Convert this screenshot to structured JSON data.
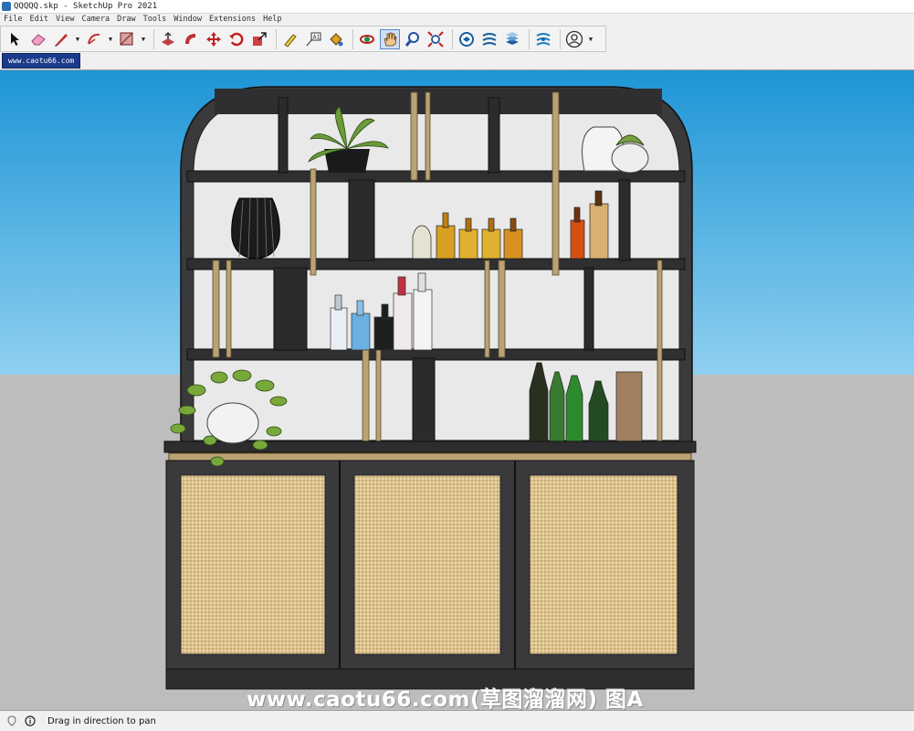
{
  "window": {
    "title": "QQQQQ.skp - SketchUp Pro 2021"
  },
  "menu": [
    "File",
    "Edit",
    "View",
    "Camera",
    "Draw",
    "Tools",
    "Window",
    "Extensions",
    "Help"
  ],
  "scene_tab": {
    "label": "www.caotu66.com"
  },
  "toolbar": {
    "tools": [
      {
        "name": "select-icon"
      },
      {
        "name": "eraser-icon"
      },
      {
        "name": "line-pencil-icon"
      },
      {
        "name": "arc-icon"
      },
      {
        "name": "rectangle-icon"
      },
      {
        "name": "push-pull-icon"
      },
      {
        "name": "follow-me-icon"
      },
      {
        "name": "move-icon"
      },
      {
        "name": "rotate-icon"
      },
      {
        "name": "scale-icon"
      },
      {
        "name": "tape-measure-icon"
      },
      {
        "name": "text-label-icon"
      },
      {
        "name": "paint-bucket-icon"
      },
      {
        "name": "orbit-icon"
      },
      {
        "name": "pan-hand-icon"
      },
      {
        "name": "zoom-icon"
      },
      {
        "name": "zoom-extents-icon"
      },
      {
        "name": "3d-warehouse-icon"
      },
      {
        "name": "extension-warehouse-icon"
      },
      {
        "name": "layout-icon"
      },
      {
        "name": "extension-manager-icon"
      },
      {
        "name": "account-icon"
      }
    ]
  },
  "watermark": {
    "text": "www.caotu66.com(草图溜溜网) 图A"
  },
  "status": {
    "text": "Drag in direction to pan"
  },
  "colors": {
    "sky": "#2a9bd8",
    "ground": "#bdbdbd",
    "cabinet": "#333333",
    "brass": "#b9a273",
    "rattan": "#d8c08d"
  }
}
